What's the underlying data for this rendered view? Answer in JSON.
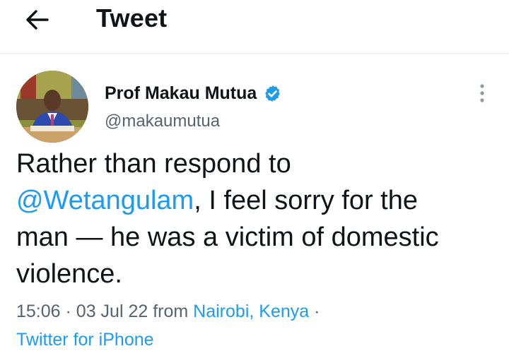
{
  "header": {
    "title": "Tweet",
    "back_icon": "arrow-left-icon"
  },
  "tweet": {
    "author": {
      "display_name": "Prof Makau Mutua",
      "handle": "@makaumutua",
      "verified": true,
      "verified_color": "#1d9bf0"
    },
    "text": {
      "line1": "Rather than respond to",
      "mention": "@Wetangulam",
      "after_mention": ", I feel sorry for the",
      "line3": "man — he was a victim of domestic",
      "line4": "violence."
    },
    "meta": {
      "time": "15:06",
      "sep": "·",
      "date": "03 Jul 22",
      "from_word": "from",
      "location": "Nairobi, Kenya",
      "source": "Twitter for iPhone"
    }
  },
  "colors": {
    "link": "#1d9bf0",
    "text": "#0f1419",
    "secondary": "#536471"
  }
}
